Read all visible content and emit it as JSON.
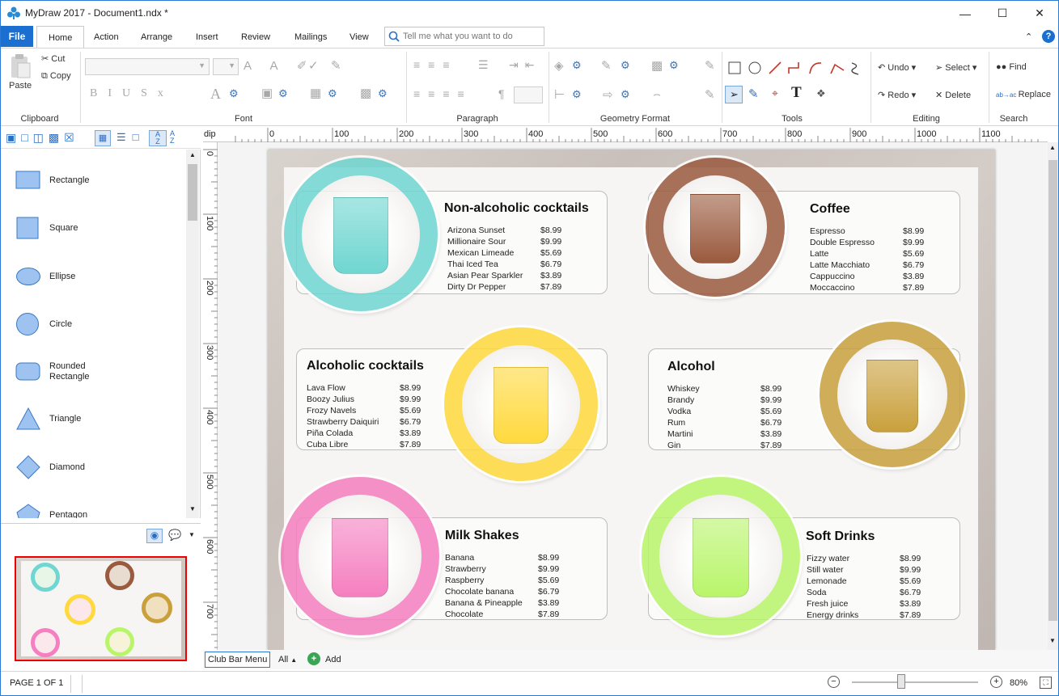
{
  "window": {
    "title": "MyDraw 2017 - Document1.ndx *"
  },
  "menu": {
    "file": "File",
    "tabs": [
      "Home",
      "Action",
      "Arrange",
      "Insert",
      "Review",
      "Mailings",
      "View"
    ],
    "tellme_placeholder": "Tell me what you want to do"
  },
  "ribbon": {
    "clipboard": {
      "paste": "Paste",
      "cut": "Cut",
      "copy": "Copy",
      "label": "Clipboard"
    },
    "font": {
      "label": "Font"
    },
    "paragraph": {
      "label": "Paragraph"
    },
    "geometry": {
      "label": "Geometry Format"
    },
    "tools": {
      "label": "Tools"
    },
    "editing": {
      "undo": "Undo",
      "redo": "Redo",
      "select": "Select",
      "delete": "Delete",
      "label": "Editing"
    },
    "search": {
      "find": "Find",
      "replace": "Replace",
      "label": "Search"
    }
  },
  "shapes": [
    "Rectangle",
    "Square",
    "Ellipse",
    "Circle",
    "Rounded Rectangle",
    "Triangle",
    "Diamond",
    "Pentagon"
  ],
  "ruler": {
    "unit": "dip",
    "top": [
      "0",
      "100",
      "200",
      "300",
      "400",
      "500",
      "600",
      "700",
      "800",
      "900",
      "1000",
      "1100"
    ],
    "left": [
      "0",
      "100",
      "200",
      "300",
      "400",
      "500",
      "600",
      "700"
    ]
  },
  "menu_sections": [
    {
      "title": "Non-alcoholic cocktails",
      "ring": "#6fd6d1",
      "items": [
        [
          "Arizona Sunset",
          "$8.99"
        ],
        [
          "Millionaire Sour",
          "$9.99"
        ],
        [
          "Mexican Limeade",
          "$5.69"
        ],
        [
          "Thai Iced Tea",
          "$6.79"
        ],
        [
          "Asian Pear Sparkler",
          "$3.89"
        ],
        [
          "Dirty Dr Pepper",
          "$7.89"
        ]
      ]
    },
    {
      "title": "Coffee",
      "ring": "#9a5a3e",
      "items": [
        [
          "Espresso",
          "$8.99"
        ],
        [
          "Double Espresso",
          "$9.99"
        ],
        [
          "Latte",
          "$5.69"
        ],
        [
          "Latte Macchiato",
          "$6.79"
        ],
        [
          "Cappuccino",
          "$3.89"
        ],
        [
          "Moccaccino",
          "$7.89"
        ]
      ]
    },
    {
      "title": "Alcoholic cocktails",
      "ring": "#ffd93d",
      "items": [
        [
          "Lava Flow",
          "$8.99"
        ],
        [
          "Boozy Julius",
          "$9.99"
        ],
        [
          "Frozy Navels",
          "$5.69"
        ],
        [
          "Strawberry Daiquiri",
          "$6.79"
        ],
        [
          "Piña Colada",
          "$3.89"
        ],
        [
          "Cuba Libre",
          "$7.89"
        ]
      ]
    },
    {
      "title": "Alcohol",
      "ring": "#c9a03c",
      "items": [
        [
          "Whiskey",
          "$8.99"
        ],
        [
          "Brandy",
          "$9.99"
        ],
        [
          "Vodka",
          "$5.69"
        ],
        [
          "Rum",
          "$6.79"
        ],
        [
          "Martini",
          "$3.89"
        ],
        [
          "Gin",
          "$7.89"
        ]
      ]
    },
    {
      "title": "Milk Shakes",
      "ring": "#f57fc0",
      "items": [
        [
          "Banana",
          "$8.99"
        ],
        [
          "Strawberry",
          "$9.99"
        ],
        [
          "Raspberry",
          "$5.69"
        ],
        [
          "Chocolate banana",
          "$6.79"
        ],
        [
          "Banana & Pineapple",
          "$3.89"
        ],
        [
          "Chocolate",
          "$7.89"
        ]
      ]
    },
    {
      "title": "Soft Drinks",
      "ring": "#b9f56a",
      "items": [
        [
          "Fizzy water",
          "$8.99"
        ],
        [
          "Still water",
          "$9.99"
        ],
        [
          "Lemonade",
          "$5.69"
        ],
        [
          "Soda",
          "$6.79"
        ],
        [
          "Fresh juice",
          "$3.89"
        ],
        [
          "Energy drinks",
          "$7.89"
        ]
      ]
    }
  ],
  "sheets": {
    "active": "Club Bar Menu",
    "all": "All",
    "add": "Add"
  },
  "status": {
    "page": "PAGE 1 OF 1",
    "zoom": "80%"
  }
}
